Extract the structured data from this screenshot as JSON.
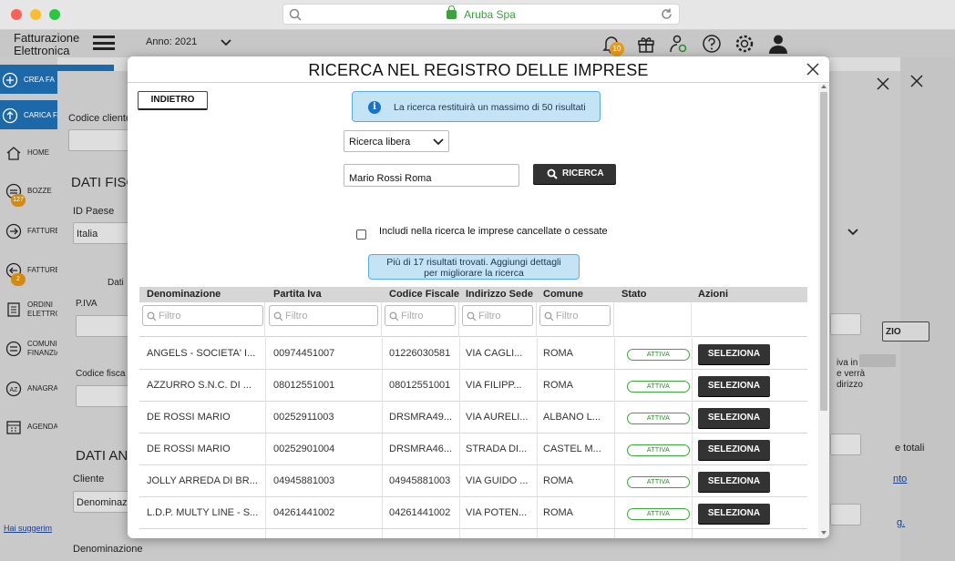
{
  "browser": {
    "url_text": "Aruba Spa"
  },
  "app": {
    "brand_line1": "Fatturazione",
    "brand_line2": "Elettronica",
    "anno_label": "Anno: 2021",
    "notifications_count": "10"
  },
  "sidebar": {
    "items": [
      {
        "label": "CREA FA"
      },
      {
        "label": "CARICA FA"
      },
      {
        "label": "HOME"
      },
      {
        "label": "BOZZE",
        "badge": "127"
      },
      {
        "label": "FATTURE"
      },
      {
        "label": "FATTURE",
        "badge": "2"
      },
      {
        "label": "ORDINI",
        "label2": "ELETTRO"
      },
      {
        "label": "COMUNI",
        "label2": "FINANZIA"
      },
      {
        "label": "ANAGRA"
      },
      {
        "label": "AGENDA"
      }
    ],
    "help_link": "Hai suggerim"
  },
  "background": {
    "codice_cliente": "Codice cliente",
    "dati_fiscali": "DATI FISC",
    "id_paese": "ID Paese",
    "italia": "Italia",
    "dati": "Dati",
    "piva": "P.IVA",
    "codice_fiscale": "Codice fisca",
    "dati_anagrafici": "DATI AN",
    "cliente": "Cliente",
    "denominaz": "Denominaz",
    "denominazione": "Denominazione",
    "right_btn": "ZIO",
    "right_text1": "iva in",
    "right_text2": "e verrà",
    "right_text3": "dirizzo",
    "right_text4": "e totali",
    "right_link1": "nto",
    "right_link2": "g."
  },
  "modal": {
    "title": "RICERCA NEL REGISTRO DELLE IMPRESE",
    "back_label": "INDIETRO",
    "info_text": "La ricerca restituirà un massimo di 50 risultati",
    "search_type": "Ricerca libera",
    "query_value": "Mario Rossi Roma",
    "search_button": "RICERCA",
    "include_cancelled_label": "Includi nella ricerca le imprese cancellate o cessate",
    "results_line1": "Più di 17 risultati trovati. Aggiungi dettagli",
    "results_line2": "per migliorare la ricerca",
    "filter_placeholder": "Filtro",
    "columns": [
      "Denominazione",
      "Partita Iva",
      "Codice Fiscale",
      "Indirizzo Sede",
      "Comune",
      "Stato",
      "Azioni"
    ],
    "select_label": "SELEZIONA",
    "rows": [
      {
        "denominazione": "ANGELS - SOCIETA' I...",
        "piva": "00974451007",
        "cf": "01226030581",
        "indirizzo": "VIA CAGLI...",
        "comune": "ROMA",
        "stato": "ATTIVA"
      },
      {
        "denominazione": "AZZURRO S.N.C. DI ...",
        "piva": "08012551001",
        "cf": "08012551001",
        "indirizzo": "VIA FILIPP...",
        "comune": "ROMA",
        "stato": "ATTIVA"
      },
      {
        "denominazione": "DE ROSSI MARIO",
        "piva": "00252911003",
        "cf": "DRSMRA49...",
        "indirizzo": "VIA AURELI...",
        "comune": "ALBANO L...",
        "stato": "ATTIVA"
      },
      {
        "denominazione": "DE ROSSI MARIO",
        "piva": "00252901004",
        "cf": "DRSMRA46...",
        "indirizzo": "STRADA DI...",
        "comune": "CASTEL M...",
        "stato": "ATTIVA"
      },
      {
        "denominazione": "JOLLY ARREDA DI BR...",
        "piva": "04945881003",
        "cf": "04945881003",
        "indirizzo": "VIA GUIDO ...",
        "comune": "ROMA",
        "stato": "ATTIVA"
      },
      {
        "denominazione": "L.D.P. MULTY LINE - S...",
        "piva": "04261441002",
        "cf": "04261441002",
        "indirizzo": "VIA POTEN...",
        "comune": "ROMA",
        "stato": "ATTIVA"
      }
    ]
  }
}
